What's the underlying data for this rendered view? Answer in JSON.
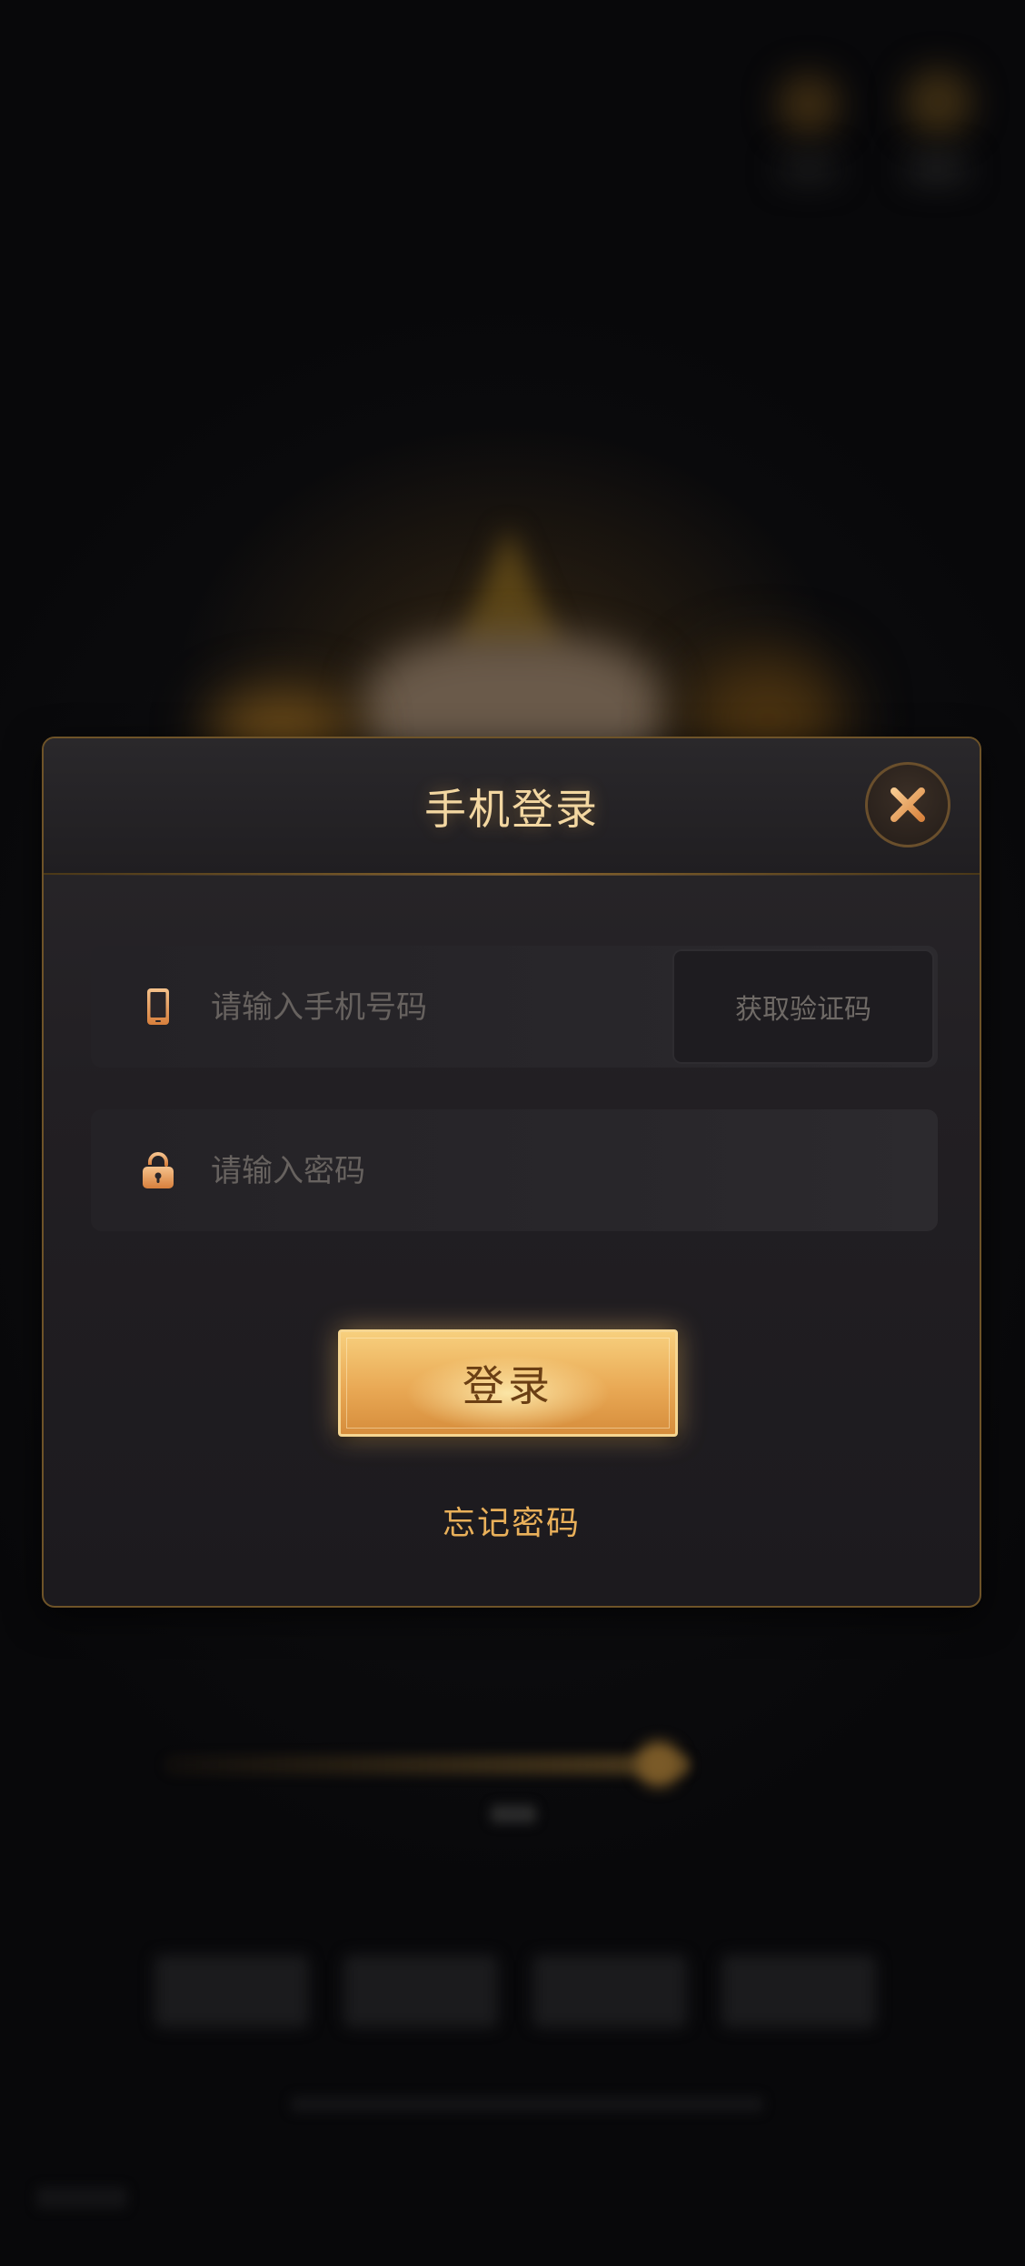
{
  "dialog": {
    "title": "手机登录",
    "close_icon": "close-icon"
  },
  "phone_field": {
    "icon": "mobile-phone-icon",
    "placeholder": "请输入手机号码",
    "value": "",
    "get_code_label": "获取验证码"
  },
  "password_field": {
    "icon": "unlock-icon",
    "placeholder": "请输入密码",
    "value": ""
  },
  "login_button": {
    "label": "登录"
  },
  "forgot_password": {
    "label": "忘记密码"
  },
  "colors": {
    "accent_gold": "#f3d7a1",
    "link_orange": "#e9b05a",
    "button_gold": "#e9a955",
    "dialog_bg": "#221f23",
    "overlay_bg": "#0a0a0c"
  }
}
